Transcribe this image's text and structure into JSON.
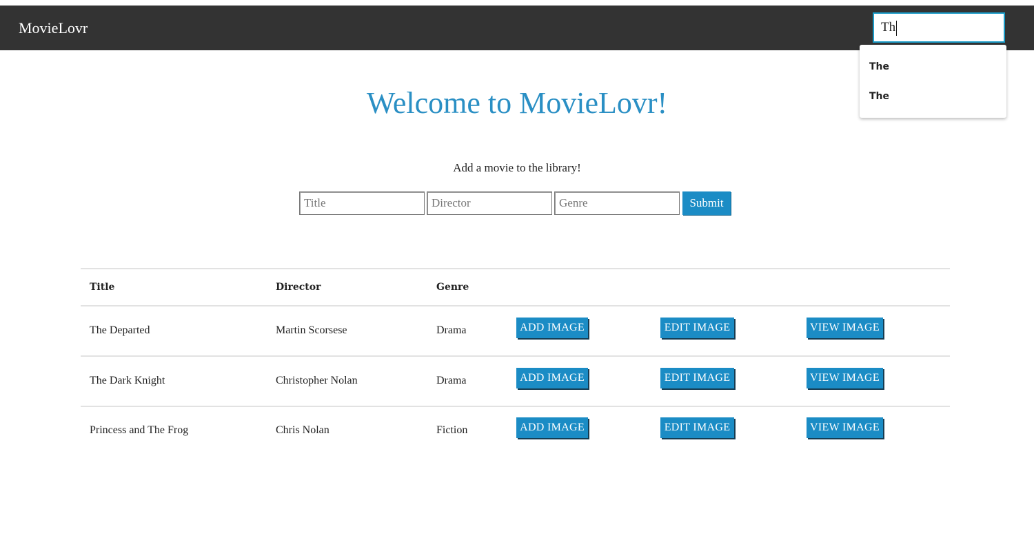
{
  "navbar": {
    "brand": "MovieLovr",
    "search_value": "Th",
    "suggestions": [
      "The",
      "The"
    ]
  },
  "main": {
    "title": "Welcome to MovieLovr!",
    "subtitle": "Add a movie to the library!",
    "form": {
      "title_placeholder": "Title",
      "director_placeholder": "Director",
      "genre_placeholder": "Genre",
      "submit_label": "Submit"
    }
  },
  "table": {
    "headers": [
      "Title",
      "Director",
      "Genre"
    ],
    "rows": [
      {
        "title": "The Departed",
        "director": "Martin Scorsese",
        "genre": "Drama"
      },
      {
        "title": "The Dark Knight",
        "director": "Christopher Nolan",
        "genre": "Drama"
      },
      {
        "title": "Princess and The Frog",
        "director": "Chris Nolan",
        "genre": "Fiction"
      }
    ],
    "actions": {
      "add_label": "ADD IMAGE",
      "edit_label": "EDIT IMAGE",
      "view_label": "VIEW IMAGE"
    }
  },
  "colors": {
    "navbar": "#333333",
    "accent": "#1b8cc5",
    "title": "#2a8fc4"
  }
}
